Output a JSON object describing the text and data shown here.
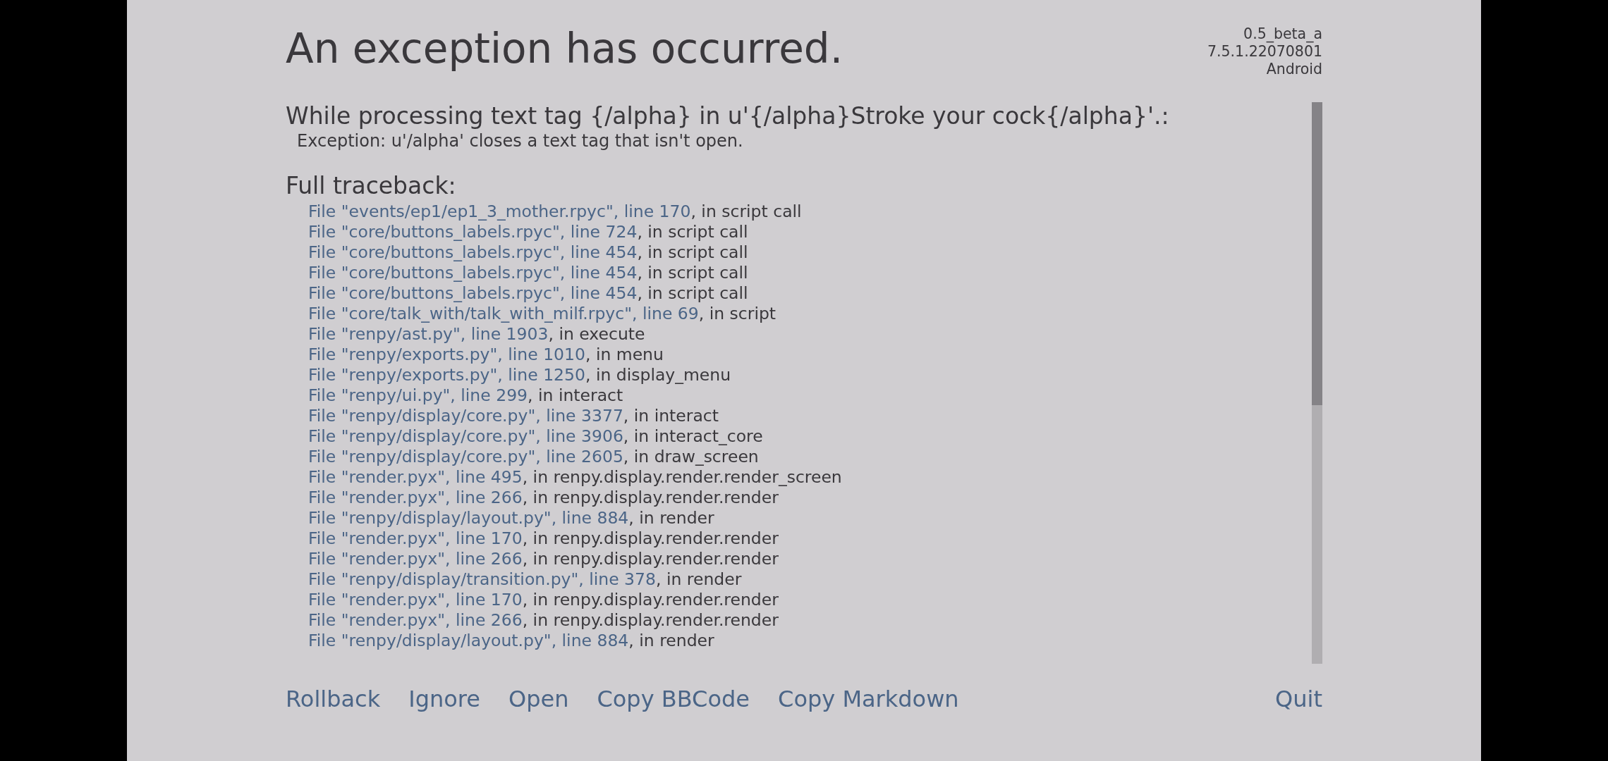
{
  "title": "An exception has occurred.",
  "version": [
    "0.5_beta_a",
    "7.5.1.22070801",
    "Android"
  ],
  "message": "While processing text tag {/alpha} in u'{/alpha}Stroke your cock{/alpha}'.:",
  "exception": "Exception: u'/alpha' closes a text tag that isn't open.",
  "traceback_heading": "Full traceback:",
  "traceback": [
    {
      "file": "File \"events/ep1/ep1_3_mother.rpyc\", line 170",
      "text": ", in script call"
    },
    {
      "file": "File \"core/buttons_labels.rpyc\", line 724",
      "text": ", in script call"
    },
    {
      "file": "File \"core/buttons_labels.rpyc\", line 454",
      "text": ", in script call"
    },
    {
      "file": "File \"core/buttons_labels.rpyc\", line 454",
      "text": ", in script call"
    },
    {
      "file": "File \"core/buttons_labels.rpyc\", line 454",
      "text": ", in script call"
    },
    {
      "file": "File \"core/talk_with/talk_with_milf.rpyc\", line 69",
      "text": ", in script"
    },
    {
      "file": "File \"renpy/ast.py\", line 1903",
      "text": ", in execute"
    },
    {
      "file": "File \"renpy/exports.py\", line 1010",
      "text": ", in menu"
    },
    {
      "file": "File \"renpy/exports.py\", line 1250",
      "text": ", in display_menu"
    },
    {
      "file": "File \"renpy/ui.py\", line 299",
      "text": ", in interact"
    },
    {
      "file": "File \"renpy/display/core.py\", line 3377",
      "text": ", in interact"
    },
    {
      "file": "File \"renpy/display/core.py\", line 3906",
      "text": ", in interact_core"
    },
    {
      "file": "File \"renpy/display/core.py\", line 2605",
      "text": ", in draw_screen"
    },
    {
      "file": "File \"render.pyx\", line 495",
      "text": ", in renpy.display.render.render_screen"
    },
    {
      "file": "File \"render.pyx\", line 266",
      "text": ", in renpy.display.render.render"
    },
    {
      "file": "File \"renpy/display/layout.py\", line 884",
      "text": ", in render"
    },
    {
      "file": "File \"render.pyx\", line 170",
      "text": ", in renpy.display.render.render"
    },
    {
      "file": "File \"render.pyx\", line 266",
      "text": ", in renpy.display.render.render"
    },
    {
      "file": "File \"renpy/display/transition.py\", line 378",
      "text": ", in render"
    },
    {
      "file": "File \"render.pyx\", line 170",
      "text": ", in renpy.display.render.render"
    },
    {
      "file": "File \"render.pyx\", line 266",
      "text": ", in renpy.display.render.render"
    },
    {
      "file": "File \"renpy/display/layout.py\", line 884",
      "text": ", in render"
    }
  ],
  "actions": [
    "Rollback",
    "Ignore",
    "Open",
    "Copy BBCode",
    "Copy Markdown"
  ],
  "quit": "Quit"
}
